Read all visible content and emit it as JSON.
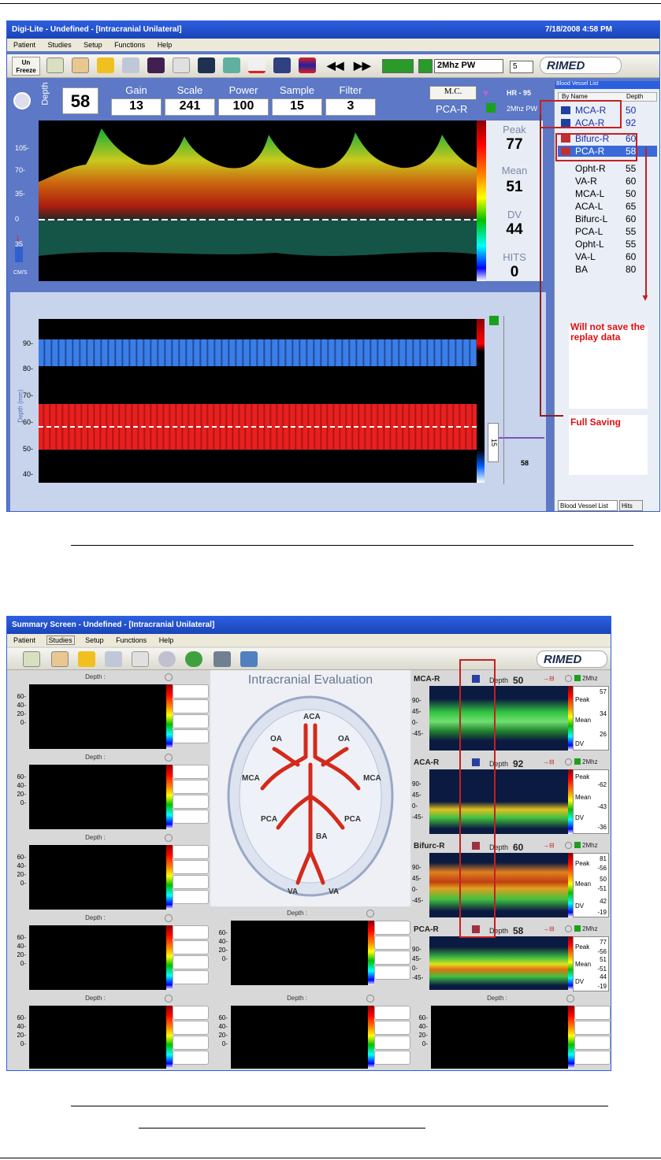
{
  "screen1": {
    "title": "Digi-Lite - Undefined - [Intracranial Unilateral]",
    "datetime": "7/18/2008 4:58 PM",
    "menu": [
      "Patient",
      "Studies",
      "Setup",
      "Functions",
      "Help"
    ],
    "toolbar": {
      "unfreeze_label": "Un Freeze",
      "probe_select": "2Mhz PW",
      "gain_select": "5",
      "logo": "RIMED"
    },
    "params": {
      "depth_label": "Depth",
      "depth": "58",
      "gain_label": "Gain",
      "gain": "13",
      "scale_label": "Scale",
      "scale": "241",
      "power_label": "Power",
      "power": "100",
      "sample_label": "Sample",
      "sample": "15",
      "filter_label": "Filter",
      "filter": "3"
    },
    "mc_button": "M.C.",
    "vessel_name": "PCA-R",
    "hr": "HR - 95",
    "probe": "2Mhz PW",
    "stats": {
      "peak_label": "Peak",
      "peak": "77",
      "mean_label": "Mean",
      "mean": "51",
      "dv_label": "DV",
      "dv": "44",
      "hits_label": "HITS",
      "hits": "0"
    },
    "spectrum_axis": [
      "105-",
      "70-",
      "35-",
      "0",
      "35",
      "70"
    ],
    "cm_label": "CM/S",
    "mmode_axis": [
      "90-",
      "80-",
      "70-",
      "60-",
      "50-",
      "40-"
    ],
    "mmode_ylabel": "Depth (mm)",
    "mmode_gate": "15",
    "mmode_depth": "58",
    "blood_vessel_list": {
      "title": "Blood Vessel List",
      "col_name": "By Name",
      "col_depth": "Depth",
      "items": [
        {
          "name": "MCA-R",
          "depth": "50"
        },
        {
          "name": "ACA-R",
          "depth": "92"
        },
        {
          "name": "Bifurc-R",
          "depth": "60"
        },
        {
          "name": "PCA-R",
          "depth": "58"
        },
        {
          "name": "Opht-R",
          "depth": "55"
        },
        {
          "name": "VA-R",
          "depth": "60"
        },
        {
          "name": "MCA-L",
          "depth": "50"
        },
        {
          "name": "ACA-L",
          "depth": "65"
        },
        {
          "name": "Bifurc-L",
          "depth": "60"
        },
        {
          "name": "PCA-L",
          "depth": "55"
        },
        {
          "name": "Opht-L",
          "depth": "55"
        },
        {
          "name": "VA-L",
          "depth": "60"
        },
        {
          "name": "BA",
          "depth": "80"
        }
      ],
      "tabs": [
        "Blood Vessel List",
        "Hits"
      ]
    },
    "annotation_replay": "Will not save the replay data",
    "annotation_full": "Full Saving"
  },
  "screen2": {
    "title": "Summary Screen - Undefined - [Intracranial Unilateral]",
    "menu": [
      "Patient",
      "Studies",
      "Setup",
      "Functions",
      "Help"
    ],
    "logo": "RIMED",
    "evaluation_title": "Intracranial Evaluation",
    "brain_labels": [
      "ACA",
      "OA",
      "OA",
      "MCA",
      "MCA",
      "PCA",
      "PCA",
      "BA",
      "VA",
      "VA"
    ],
    "depth_label": "Depth :",
    "tile_axis": [
      "60-",
      "40-",
      "20-",
      "0-"
    ],
    "probe": "2Mhz",
    "vessel_axis": [
      "90-",
      "45-",
      "0-",
      "-45-"
    ],
    "vessels": [
      {
        "name": "MCA-R",
        "depth_label": "Depth",
        "depth": "50",
        "peak": "57",
        "mean": "34",
        "dv": "26",
        "peak2": "",
        "mean2": "",
        "dv2": ""
      },
      {
        "name": "ACA-R",
        "depth_label": "Depth",
        "depth": "92",
        "peak": "",
        "mean": "",
        "dv": "",
        "peak2": "-62",
        "mean2": "-43",
        "dv2": "-36"
      },
      {
        "name": "Bifurc-R",
        "depth_label": "Depth",
        "depth": "60",
        "peak": "81",
        "mean": "50",
        "dv": "42",
        "peak2": "-56",
        "mean2": "-51",
        "dv2": "-19"
      },
      {
        "name": "PCA-R",
        "depth_label": "Depth",
        "depth": "58",
        "peak": "77",
        "mean": "51",
        "dv": "44",
        "peak2": "-56",
        "mean2": "-51",
        "dv2": "-19"
      }
    ],
    "stat_labels": {
      "peak": "Peak",
      "mean": "Mean",
      "dv": "DV"
    }
  }
}
